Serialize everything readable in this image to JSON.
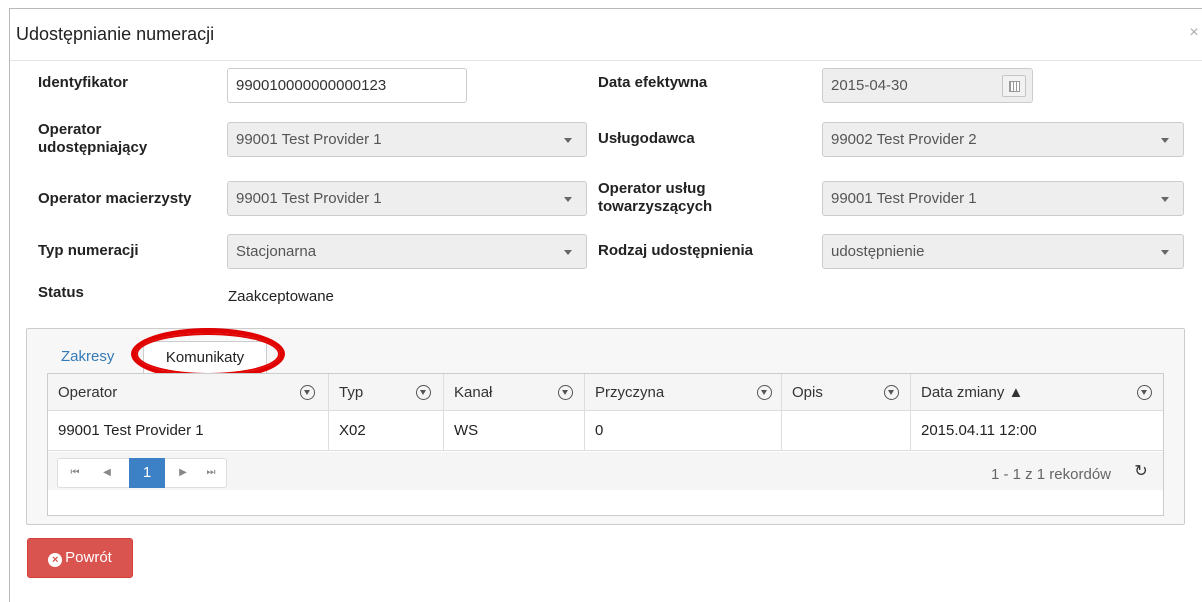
{
  "modal": {
    "title": "Udostępnianie numeracji",
    "close_glyph": "×"
  },
  "form": {
    "identyfikator": {
      "label": "Identyfikator",
      "value": "990010000000000123"
    },
    "data_efektywna": {
      "label": "Data efektywna",
      "value": "2015-04-30",
      "icon": "calendar-icon"
    },
    "operator_udostepniajacy": {
      "label_line1": "Operator",
      "label_line2": "udostępniający",
      "value": "99001 Test Provider 1"
    },
    "uslugodawca": {
      "label": "Usługodawca",
      "value": "99002 Test Provider 2"
    },
    "operator_macierzysty": {
      "label": "Operator macierzysty",
      "value": "99001 Test Provider 1"
    },
    "operator_uslug": {
      "label_line1": "Operator usług",
      "label_line2": "towarzyszących",
      "value": "99001 Test Provider 1"
    },
    "typ_numeracji": {
      "label": "Typ numeracji",
      "value": "Stacjonarna"
    },
    "rodzaj": {
      "label": "Rodzaj udostępnienia",
      "value": "udostępnienie"
    },
    "status": {
      "label": "Status",
      "value": "Zaakceptowane"
    }
  },
  "tabs": [
    {
      "label": "Zakresy",
      "active": false
    },
    {
      "label": "Komunikaty",
      "active": true
    }
  ],
  "annotation": {
    "color": "#e00000",
    "shape": "ellipse"
  },
  "grid": {
    "columns": [
      {
        "label": "Operator"
      },
      {
        "label": "Typ"
      },
      {
        "label": "Kanał"
      },
      {
        "label": "Przyczyna"
      },
      {
        "label": "Opis"
      },
      {
        "label": "Data zmiany ▲"
      }
    ],
    "rows": [
      [
        "99001 Test Provider 1",
        "X02",
        "WS",
        "0",
        "",
        "2015.04.11 12:00"
      ]
    ],
    "pager": {
      "first": "⏮",
      "prev": "◀",
      "current": "1",
      "next": "▶",
      "last": "⏭",
      "info": "1 - 1 z 1 rekordów",
      "refresh_icon": "refresh-icon"
    }
  },
  "actions": {
    "back_label": "Powrót",
    "back_icon": "times-circle-icon",
    "back_color": "#d9534f"
  },
  "colors": {
    "link": "#337ab7",
    "pager_active": "#3c80c6"
  }
}
